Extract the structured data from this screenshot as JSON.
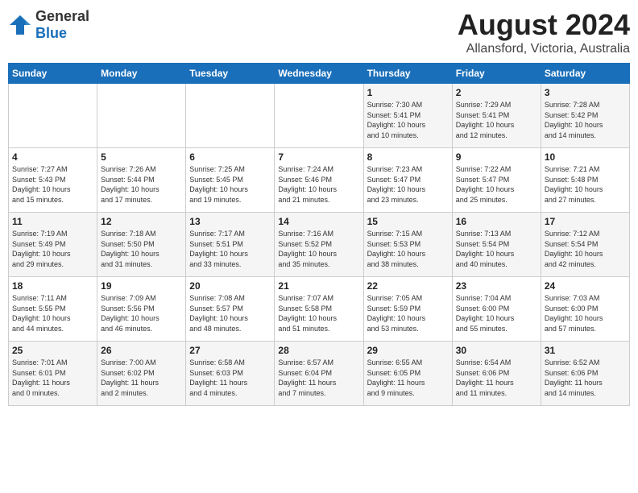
{
  "header": {
    "logo_general": "General",
    "logo_blue": "Blue",
    "title": "August 2024",
    "location": "Allansford, Victoria, Australia"
  },
  "weekdays": [
    "Sunday",
    "Monday",
    "Tuesday",
    "Wednesday",
    "Thursday",
    "Friday",
    "Saturday"
  ],
  "weeks": [
    [
      {
        "day": "",
        "info": ""
      },
      {
        "day": "",
        "info": ""
      },
      {
        "day": "",
        "info": ""
      },
      {
        "day": "",
        "info": ""
      },
      {
        "day": "1",
        "info": "Sunrise: 7:30 AM\nSunset: 5:41 PM\nDaylight: 10 hours\nand 10 minutes."
      },
      {
        "day": "2",
        "info": "Sunrise: 7:29 AM\nSunset: 5:41 PM\nDaylight: 10 hours\nand 12 minutes."
      },
      {
        "day": "3",
        "info": "Sunrise: 7:28 AM\nSunset: 5:42 PM\nDaylight: 10 hours\nand 14 minutes."
      }
    ],
    [
      {
        "day": "4",
        "info": "Sunrise: 7:27 AM\nSunset: 5:43 PM\nDaylight: 10 hours\nand 15 minutes."
      },
      {
        "day": "5",
        "info": "Sunrise: 7:26 AM\nSunset: 5:44 PM\nDaylight: 10 hours\nand 17 minutes."
      },
      {
        "day": "6",
        "info": "Sunrise: 7:25 AM\nSunset: 5:45 PM\nDaylight: 10 hours\nand 19 minutes."
      },
      {
        "day": "7",
        "info": "Sunrise: 7:24 AM\nSunset: 5:46 PM\nDaylight: 10 hours\nand 21 minutes."
      },
      {
        "day": "8",
        "info": "Sunrise: 7:23 AM\nSunset: 5:47 PM\nDaylight: 10 hours\nand 23 minutes."
      },
      {
        "day": "9",
        "info": "Sunrise: 7:22 AM\nSunset: 5:47 PM\nDaylight: 10 hours\nand 25 minutes."
      },
      {
        "day": "10",
        "info": "Sunrise: 7:21 AM\nSunset: 5:48 PM\nDaylight: 10 hours\nand 27 minutes."
      }
    ],
    [
      {
        "day": "11",
        "info": "Sunrise: 7:19 AM\nSunset: 5:49 PM\nDaylight: 10 hours\nand 29 minutes."
      },
      {
        "day": "12",
        "info": "Sunrise: 7:18 AM\nSunset: 5:50 PM\nDaylight: 10 hours\nand 31 minutes."
      },
      {
        "day": "13",
        "info": "Sunrise: 7:17 AM\nSunset: 5:51 PM\nDaylight: 10 hours\nand 33 minutes."
      },
      {
        "day": "14",
        "info": "Sunrise: 7:16 AM\nSunset: 5:52 PM\nDaylight: 10 hours\nand 35 minutes."
      },
      {
        "day": "15",
        "info": "Sunrise: 7:15 AM\nSunset: 5:53 PM\nDaylight: 10 hours\nand 38 minutes."
      },
      {
        "day": "16",
        "info": "Sunrise: 7:13 AM\nSunset: 5:54 PM\nDaylight: 10 hours\nand 40 minutes."
      },
      {
        "day": "17",
        "info": "Sunrise: 7:12 AM\nSunset: 5:54 PM\nDaylight: 10 hours\nand 42 minutes."
      }
    ],
    [
      {
        "day": "18",
        "info": "Sunrise: 7:11 AM\nSunset: 5:55 PM\nDaylight: 10 hours\nand 44 minutes."
      },
      {
        "day": "19",
        "info": "Sunrise: 7:09 AM\nSunset: 5:56 PM\nDaylight: 10 hours\nand 46 minutes."
      },
      {
        "day": "20",
        "info": "Sunrise: 7:08 AM\nSunset: 5:57 PM\nDaylight: 10 hours\nand 48 minutes."
      },
      {
        "day": "21",
        "info": "Sunrise: 7:07 AM\nSunset: 5:58 PM\nDaylight: 10 hours\nand 51 minutes."
      },
      {
        "day": "22",
        "info": "Sunrise: 7:05 AM\nSunset: 5:59 PM\nDaylight: 10 hours\nand 53 minutes."
      },
      {
        "day": "23",
        "info": "Sunrise: 7:04 AM\nSunset: 6:00 PM\nDaylight: 10 hours\nand 55 minutes."
      },
      {
        "day": "24",
        "info": "Sunrise: 7:03 AM\nSunset: 6:00 PM\nDaylight: 10 hours\nand 57 minutes."
      }
    ],
    [
      {
        "day": "25",
        "info": "Sunrise: 7:01 AM\nSunset: 6:01 PM\nDaylight: 11 hours\nand 0 minutes."
      },
      {
        "day": "26",
        "info": "Sunrise: 7:00 AM\nSunset: 6:02 PM\nDaylight: 11 hours\nand 2 minutes."
      },
      {
        "day": "27",
        "info": "Sunrise: 6:58 AM\nSunset: 6:03 PM\nDaylight: 11 hours\nand 4 minutes."
      },
      {
        "day": "28",
        "info": "Sunrise: 6:57 AM\nSunset: 6:04 PM\nDaylight: 11 hours\nand 7 minutes."
      },
      {
        "day": "29",
        "info": "Sunrise: 6:55 AM\nSunset: 6:05 PM\nDaylight: 11 hours\nand 9 minutes."
      },
      {
        "day": "30",
        "info": "Sunrise: 6:54 AM\nSunset: 6:06 PM\nDaylight: 11 hours\nand 11 minutes."
      },
      {
        "day": "31",
        "info": "Sunrise: 6:52 AM\nSunset: 6:06 PM\nDaylight: 11 hours\nand 14 minutes."
      }
    ]
  ]
}
